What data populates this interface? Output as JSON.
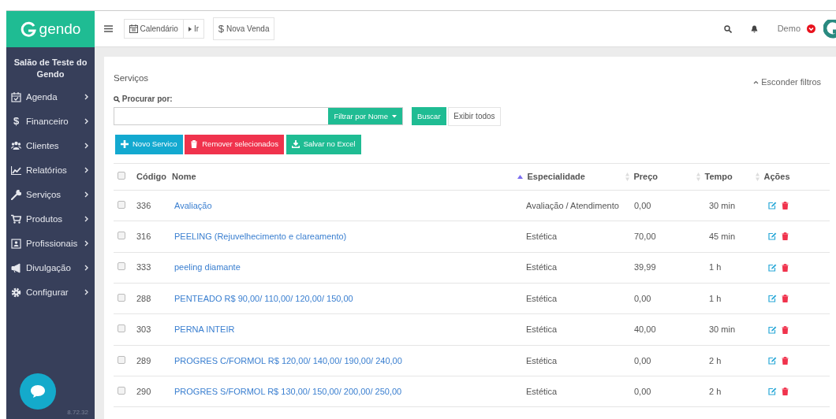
{
  "brand": {
    "name": "gendo"
  },
  "toolbar": {
    "calendar_button": "Calendário",
    "go_button": "Ir",
    "sale_button": {
      "glyph": "$",
      "label": "Nova Venda"
    },
    "user": "Demo"
  },
  "sidebar": {
    "title": "Salão de Teste do Gendo",
    "items": [
      {
        "label": "Agenda"
      },
      {
        "label": "Financeiro",
        "glyph": "$"
      },
      {
        "label": "Clientes"
      },
      {
        "label": "Relatórios"
      },
      {
        "label": "Serviços"
      },
      {
        "label": "Produtos"
      },
      {
        "label": "Profissionais"
      },
      {
        "label": "Divulgação"
      },
      {
        "label": "Configurar"
      }
    ],
    "version": "8.72.32"
  },
  "page": {
    "title": "Serviços",
    "hide_filters": "Esconder filtros",
    "search_label": "Procurar por:",
    "filter_button": "Filtrar por Nome",
    "search_button": "Buscar",
    "show_all_button": "Exibir todos",
    "actions": [
      {
        "kind": "new",
        "label": "Novo Servico"
      },
      {
        "kind": "remove",
        "label": "Remover selecionados"
      },
      {
        "kind": "excel",
        "label": "Salvar no Excel"
      }
    ]
  },
  "table": {
    "select_all": {
      "checked": false
    },
    "columns": [
      {
        "label": "Código",
        "sortable": false
      },
      {
        "label": "Nome",
        "sortable": false
      },
      {
        "label": "Especialidade",
        "sortable": true,
        "sorted": true
      },
      {
        "label": "Preço",
        "sortable": true,
        "sorted": false
      },
      {
        "label": "Tempo",
        "sortable": true,
        "sorted": false
      },
      {
        "label": "Ações",
        "sortable": true,
        "sorted": false
      }
    ],
    "rows": [
      {
        "selected": false,
        "code": "336",
        "name": "Avaliação",
        "specialty": "Avaliação / Atendimento",
        "price": "0,00",
        "time": "30 min"
      },
      {
        "selected": false,
        "code": "316",
        "name": "PEELING (Rejuvelhecimento e clareamento)",
        "specialty": "Estética",
        "price": "70,00",
        "time": "45 min"
      },
      {
        "selected": false,
        "code": "333",
        "name": "peeling diamante",
        "specialty": "Estética",
        "price": "39,99",
        "time": "1 h"
      },
      {
        "selected": false,
        "code": "288",
        "name": "PENTEADO R$ 90,00/ 110,00/ 120,00/ 150,00",
        "specialty": "Estética",
        "price": "0,00",
        "time": "1 h"
      },
      {
        "selected": false,
        "code": "303",
        "name": "PERNA INTEIR",
        "specialty": "Estética",
        "price": "40,00",
        "time": "30 min"
      },
      {
        "selected": false,
        "code": "289",
        "name": "PROGRES C/FORMOL R$ 120,00/ 140,00/ 190,00/ 240,00",
        "specialty": "Estética",
        "price": "0,00",
        "time": "2 h"
      },
      {
        "selected": false,
        "code": "290",
        "name": "PROGRES S/FORMOL R$ 130,00/ 150,00/ 200,00/ 250,00",
        "specialty": "Estética",
        "price": "0,00",
        "time": "2 h"
      }
    ]
  }
}
